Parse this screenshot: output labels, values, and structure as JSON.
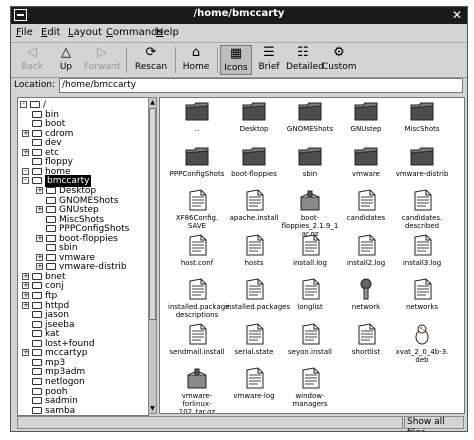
{
  "window": {
    "title": "/home/bmccarty"
  },
  "menu": [
    "File",
    "Edit",
    "Layout",
    "Commands",
    "Help"
  ],
  "toolbar": [
    {
      "label": "Back",
      "icon": "back-arrow-icon",
      "enabled": false
    },
    {
      "label": "Up",
      "icon": "up-arrow-icon",
      "enabled": true
    },
    {
      "label": "Forward",
      "icon": "forward-arrow-icon",
      "enabled": false
    },
    {
      "label": "Rescan",
      "icon": "rescan-icon",
      "enabled": true
    },
    {
      "label": "Home",
      "icon": "home-icon",
      "enabled": true
    },
    {
      "label": "Icons",
      "icon": "icons-view-icon",
      "enabled": true,
      "active": true
    },
    {
      "label": "Brief",
      "icon": "brief-view-icon",
      "enabled": true
    },
    {
      "label": "Detailed",
      "icon": "detailed-view-icon",
      "enabled": true
    },
    {
      "label": "Custom",
      "icon": "custom-view-icon",
      "enabled": true
    }
  ],
  "location": {
    "label": "Location:",
    "value": "/home/bmccarty"
  },
  "tree": [
    {
      "label": "/",
      "depth": 0,
      "exp": "-"
    },
    {
      "label": "bin",
      "depth": 1,
      "exp": ""
    },
    {
      "label": "boot",
      "depth": 1,
      "exp": ""
    },
    {
      "label": "cdrom",
      "depth": 1,
      "exp": "+"
    },
    {
      "label": "dev",
      "depth": 1,
      "exp": ""
    },
    {
      "label": "etc",
      "depth": 1,
      "exp": "+"
    },
    {
      "label": "floppy",
      "depth": 1,
      "exp": ""
    },
    {
      "label": "home",
      "depth": 1,
      "exp": "-"
    },
    {
      "label": "bmccarty",
      "depth": 2,
      "exp": "-",
      "selected": true
    },
    {
      "label": "Desktop",
      "depth": 3,
      "exp": "+"
    },
    {
      "label": "GNOMEShots",
      "depth": 3,
      "exp": ""
    },
    {
      "label": "GNUstep",
      "depth": 3,
      "exp": "+"
    },
    {
      "label": "MiscShots",
      "depth": 3,
      "exp": ""
    },
    {
      "label": "PPPConfigShots",
      "depth": 3,
      "exp": ""
    },
    {
      "label": "boot-floppies",
      "depth": 3,
      "exp": "+"
    },
    {
      "label": "sbin",
      "depth": 3,
      "exp": ""
    },
    {
      "label": "vmware",
      "depth": 3,
      "exp": "+"
    },
    {
      "label": "vmware-distrib",
      "depth": 3,
      "exp": "+"
    },
    {
      "label": "bnet",
      "depth": 2,
      "exp": "+"
    },
    {
      "label": "conj",
      "depth": 2,
      "exp": "+"
    },
    {
      "label": "ftp",
      "depth": 2,
      "exp": "+"
    },
    {
      "label": "httpd",
      "depth": 2,
      "exp": "+"
    },
    {
      "label": "jason",
      "depth": 2,
      "exp": ""
    },
    {
      "label": "jseeba",
      "depth": 2,
      "exp": ""
    },
    {
      "label": "kat",
      "depth": 2,
      "exp": ""
    },
    {
      "label": "lost+found",
      "depth": 2,
      "exp": ""
    },
    {
      "label": "mccartyp",
      "depth": 2,
      "exp": "+"
    },
    {
      "label": "mp3",
      "depth": 2,
      "exp": ""
    },
    {
      "label": "mp3adm",
      "depth": 2,
      "exp": ""
    },
    {
      "label": "netlogon",
      "depth": 2,
      "exp": ""
    },
    {
      "label": "pooh",
      "depth": 2,
      "exp": ""
    },
    {
      "label": "sadmin",
      "depth": 2,
      "exp": ""
    },
    {
      "label": "samba",
      "depth": 2,
      "exp": ""
    }
  ],
  "files": [
    {
      "name": "..",
      "type": "folder"
    },
    {
      "name": "Desktop",
      "type": "folder"
    },
    {
      "name": "GNOMEShots",
      "type": "folder"
    },
    {
      "name": "GNUstep",
      "type": "folder"
    },
    {
      "name": "MiscShots",
      "type": "folder"
    },
    {
      "name": "PPPConfigShots",
      "type": "folder"
    },
    {
      "name": "boot-floppies",
      "type": "folder"
    },
    {
      "name": "sbin",
      "type": "folder"
    },
    {
      "name": "vmware",
      "type": "folder"
    },
    {
      "name": "vmware-distrib",
      "type": "folder"
    },
    {
      "name": "XF86Config.\nSAVE",
      "type": "doc"
    },
    {
      "name": "apache.install",
      "type": "doc"
    },
    {
      "name": "boot-\nfloppies_2.1.9_1\nar.gz",
      "type": "archive"
    },
    {
      "name": "candidates",
      "type": "doc"
    },
    {
      "name": "candidates.\ndescribed",
      "type": "doc"
    },
    {
      "name": "host.conf",
      "type": "doc"
    },
    {
      "name": "hosts",
      "type": "doc"
    },
    {
      "name": "install.log",
      "type": "doc"
    },
    {
      "name": "install2.log",
      "type": "doc"
    },
    {
      "name": "install3.log",
      "type": "doc"
    },
    {
      "name": "installed.package\ndescriptions",
      "type": "doc"
    },
    {
      "name": "installed.packages",
      "type": "doc"
    },
    {
      "name": "longlist",
      "type": "doc"
    },
    {
      "name": "network",
      "type": "config"
    },
    {
      "name": "networks",
      "type": "doc"
    },
    {
      "name": "sendmail.install",
      "type": "doc"
    },
    {
      "name": "serial.state",
      "type": "doc"
    },
    {
      "name": "seyon.install",
      "type": "doc"
    },
    {
      "name": "shortlist",
      "type": "doc"
    },
    {
      "name": "xvat_2_0_4b-3.\ndeb",
      "type": "deb"
    },
    {
      "name": "vmware-forlinux-\n102_tar.gz",
      "type": "archive"
    },
    {
      "name": "vmware-log",
      "type": "doc"
    },
    {
      "name": "window-\nmanagers",
      "type": "doc"
    }
  ],
  "status": {
    "left": "",
    "right": "Show all files"
  }
}
